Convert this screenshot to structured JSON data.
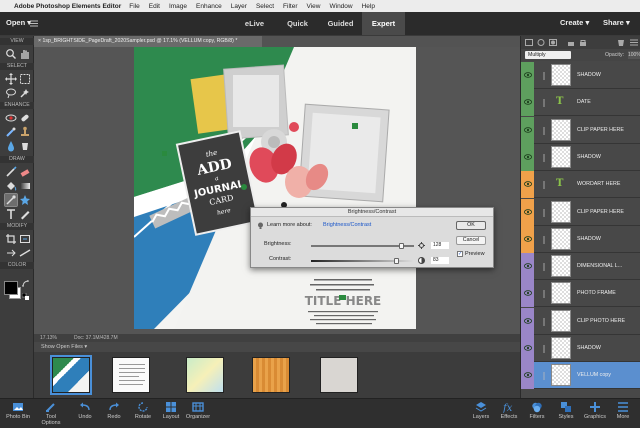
{
  "menubar": {
    "app": "Adobe Photoshop Elements Editor",
    "items": [
      "File",
      "Edit",
      "Image",
      "Enhance",
      "Layer",
      "Select",
      "Filter",
      "View",
      "Window",
      "Help"
    ]
  },
  "modebar": {
    "open_label": "Open",
    "tabs": [
      "eLive",
      "Quick",
      "Guided",
      "Expert"
    ],
    "active_tab": "Expert",
    "create_label": "Create",
    "share_label": "Share"
  },
  "document": {
    "tab_title": "1sp_BRIGHTSIDE_PageDraft_2020Sampler.psd @ 17.1% (VELLUM copy, RGB/8) *",
    "zoom": "17.13%",
    "doc_size": "Doc: 37.1M/428.7M",
    "artwork": {
      "card_line1": "the",
      "card_line2": "ADD",
      "card_line3": "a",
      "card_line4": "JOURNAL",
      "card_line5": "CARD",
      "card_line6": "here",
      "title_text": "TITLE HERE"
    }
  },
  "toolbar": {
    "sections": [
      "VIEW",
      "SELECT",
      "ENHANCE",
      "DRAW",
      "MODIFY",
      "COLOR"
    ]
  },
  "photobin": {
    "header": "Show Open Files"
  },
  "layers_panel": {
    "blend_mode": "Multiply",
    "opacity_label": "Opacity:",
    "opacity_value": "100%",
    "layers": [
      {
        "name": "SHADOW",
        "type": "pixel",
        "color": "#5e9f5e"
      },
      {
        "name": "DATE",
        "type": "text",
        "color": "#5e9f5e"
      },
      {
        "name": "CLIP PAPER HERE",
        "type": "pixel",
        "color": "#5e9f5e"
      },
      {
        "name": "SHADOW",
        "type": "pixel",
        "color": "#5e9f5e"
      },
      {
        "name": "WORDART HERE",
        "type": "text",
        "color": "#f0a14a"
      },
      {
        "name": "CLIP PAPER HERE",
        "type": "pixel",
        "color": "#f0a14a"
      },
      {
        "name": "SHADOW",
        "type": "pixel",
        "color": "#f0a14a"
      },
      {
        "name": "DIMENSIONAL L...",
        "type": "pixel",
        "color": "#9a86c8"
      },
      {
        "name": "PHOTO FRAME",
        "type": "pixel",
        "color": "#9a86c8"
      },
      {
        "name": "CLIP PHOTO HERE",
        "type": "pixel",
        "color": "#9a86c8"
      },
      {
        "name": "SHADOW",
        "type": "pixel",
        "color": "#9a86c8"
      },
      {
        "name": "VELLUM copy",
        "type": "pixel",
        "color": "#9a86c8",
        "selected": true
      }
    ]
  },
  "bottombar": {
    "left": [
      "Photo Bin",
      "Tool Options",
      "Undo",
      "Redo",
      "Rotate",
      "Layout",
      "Organizer"
    ],
    "right": [
      "Layers",
      "Effects",
      "Filters",
      "Styles",
      "Graphics",
      "More"
    ]
  },
  "dialog": {
    "title": "Brightness/Contrast",
    "learn_prefix": "Learn more about:",
    "learn_link": "Brightness/Contrast",
    "brightness_label": "Brightness:",
    "brightness_value": "128",
    "brightness_level": 0.88,
    "contrast_label": "Contrast:",
    "contrast_value": "83",
    "contrast_level": 0.83,
    "ok_label": "OK",
    "cancel_label": "Cancel",
    "preview_label": "Preview",
    "preview_checked": true
  }
}
